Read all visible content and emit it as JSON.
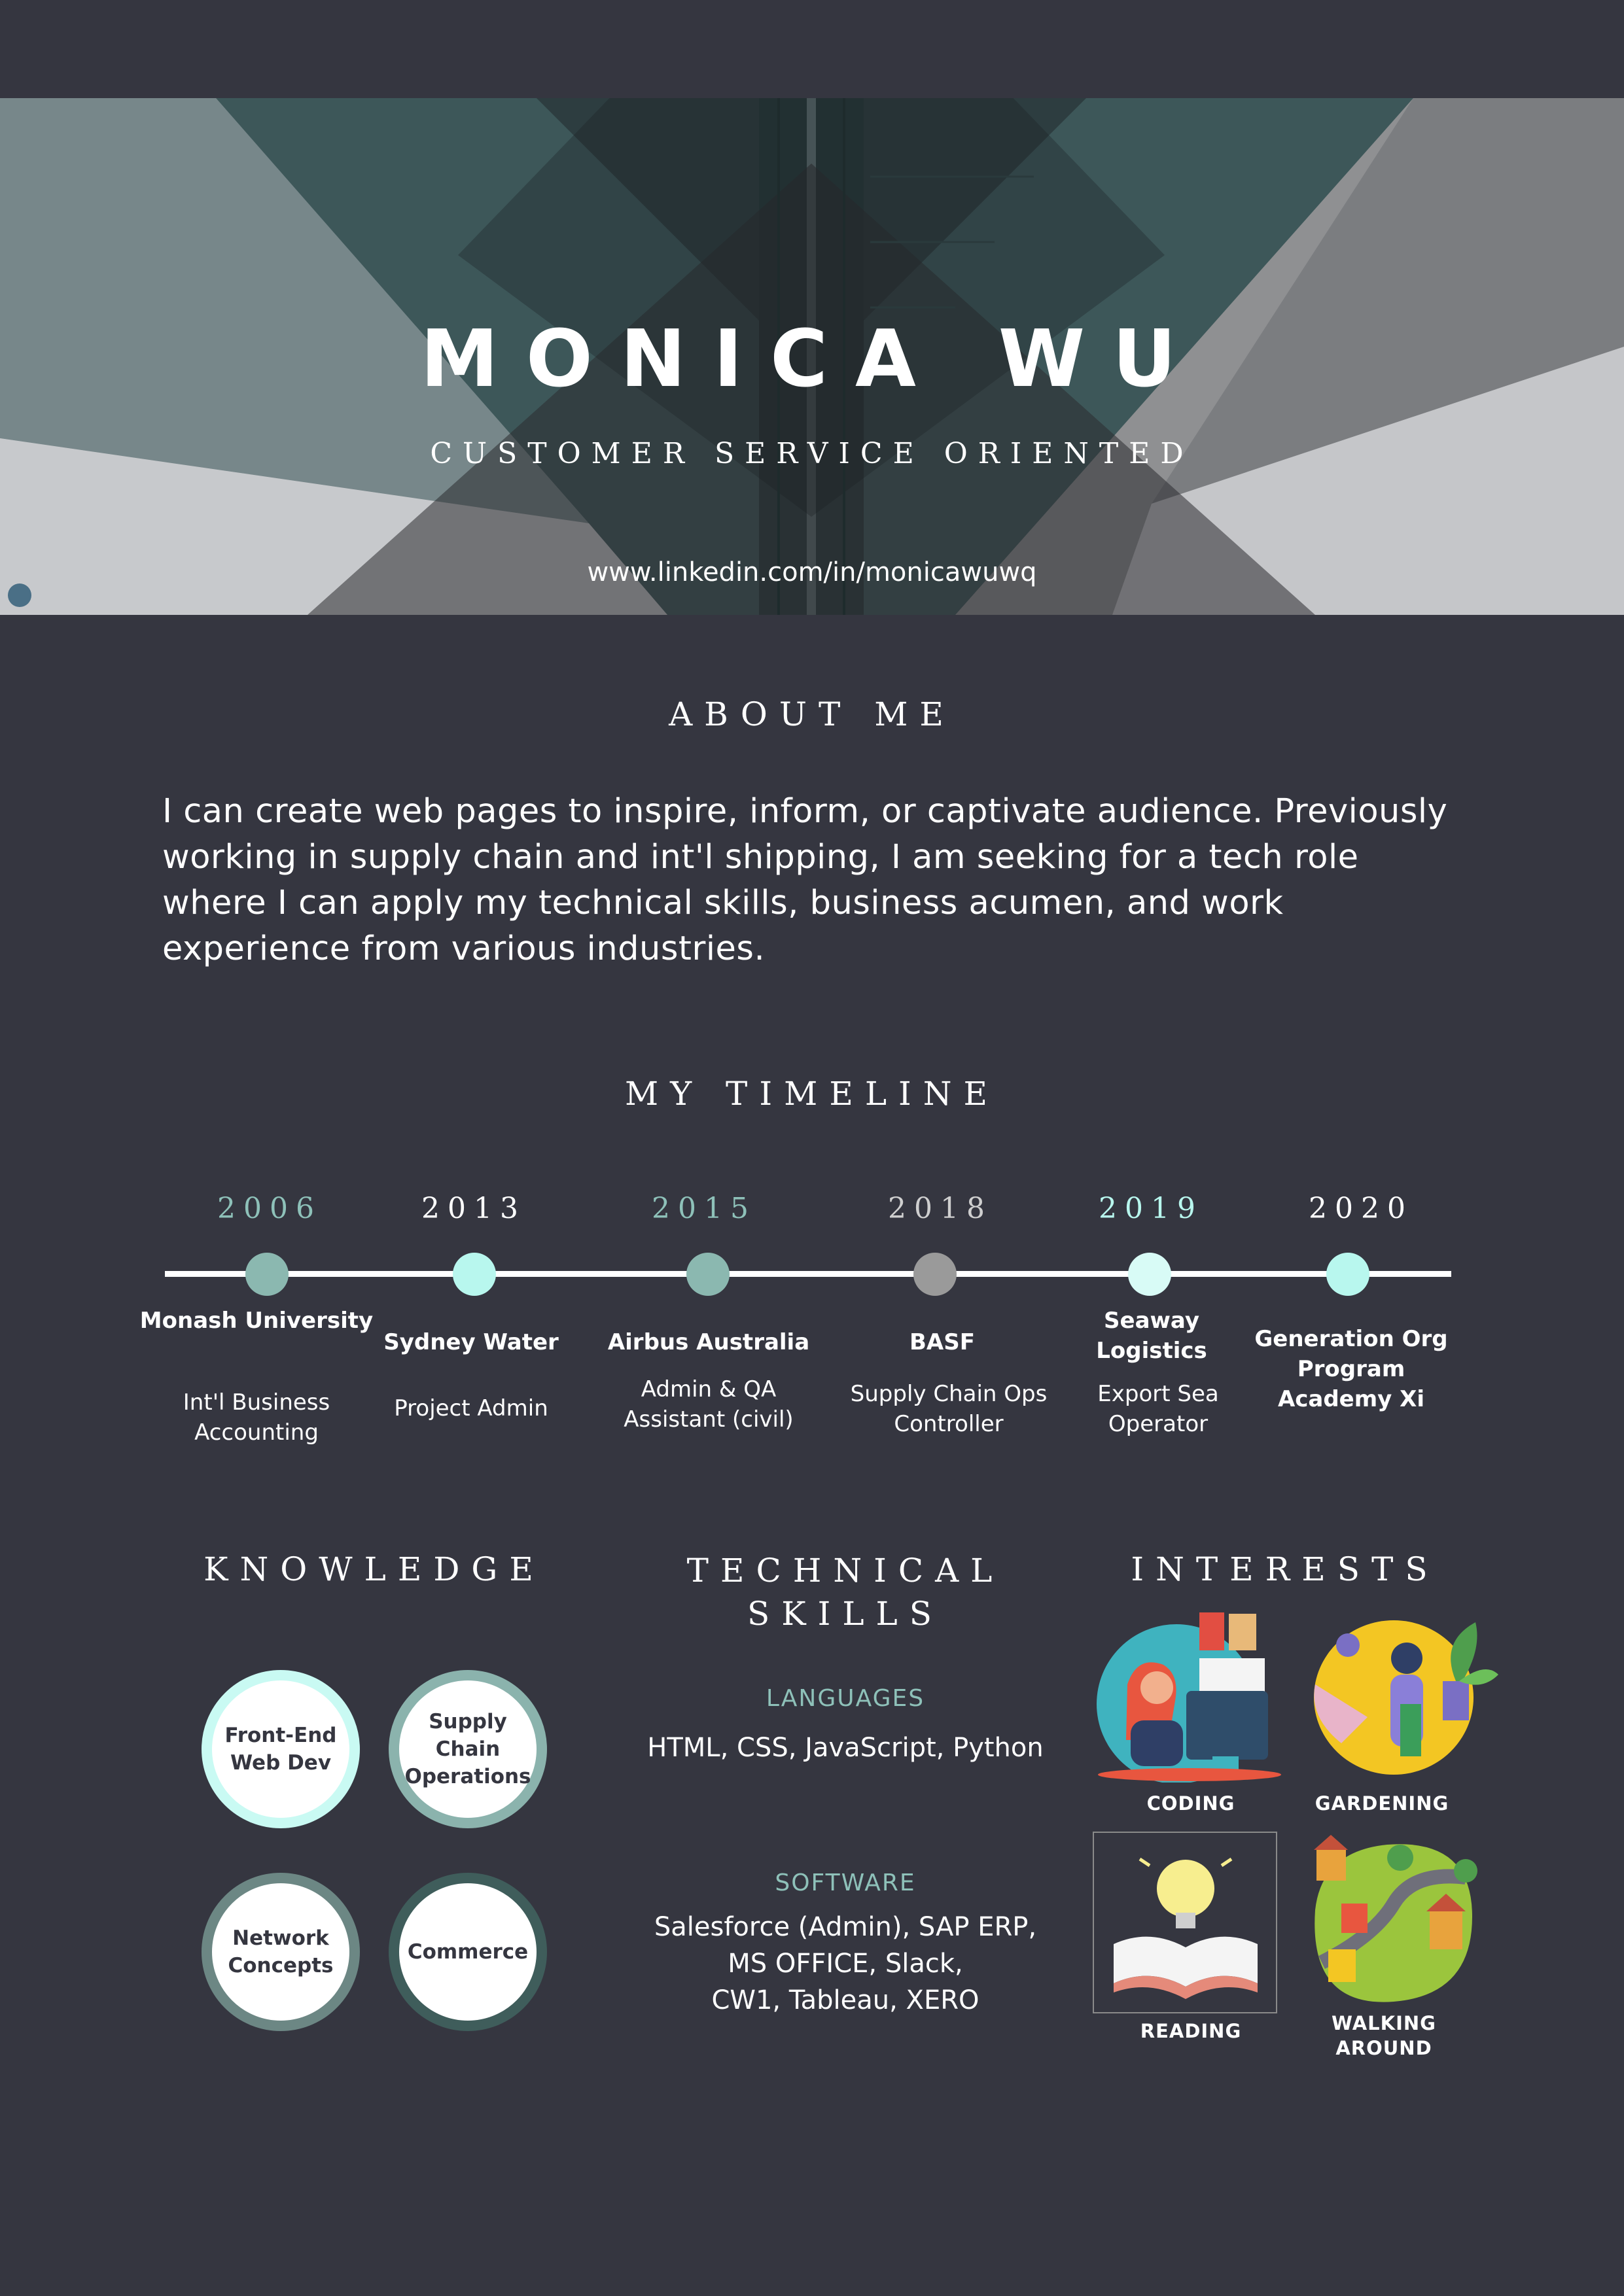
{
  "header": {
    "name": "MONICA WU",
    "tagline": "CUSTOMER SERVICE ORIENTED",
    "linkedin": "www.linkedin.com/in/monicawuwq"
  },
  "about": {
    "title": "ABOUT ME",
    "text": "I can create web pages to inspire, inform, or captivate audience. Previously working in supply chain and int'l shipping, I am seeking for a tech role where I can apply my technical skills, business acumen, and work experience from various industries."
  },
  "timeline": {
    "title": "MY TIMELINE",
    "items": [
      {
        "year": "2006",
        "org": "Monash University",
        "role": "Int'l Business Accounting",
        "year_color": "#8ec1b9",
        "dot_color": "#8bb8b0"
      },
      {
        "year": "2013",
        "org": "Sydney Water",
        "role": "Project Admin",
        "year_color": "#ffffff",
        "dot_color": "#b8f7ee"
      },
      {
        "year": "2015",
        "org": "Airbus Australia",
        "role": "Admin & QA Assistant (civil)",
        "year_color": "#8ec1b9",
        "dot_color": "#8bb8b0"
      },
      {
        "year": "2018",
        "org": "BASF",
        "role": "Supply Chain Ops Controller",
        "year_color": "#cfcfcf",
        "dot_color": "#9a9a9a"
      },
      {
        "year": "2019",
        "org": "Seaway Logistics",
        "role": "Export Sea Operator",
        "year_color": "#b8f7ee",
        "dot_color": "#d8fbf6"
      },
      {
        "year": "2020",
        "org": "Generation Org Program Academy Xi",
        "role": "",
        "year_color": "#ffffff",
        "dot_color": "#b8f7ee"
      }
    ]
  },
  "knowledge": {
    "title": "KNOWLEDGE",
    "items": [
      {
        "label": "Front-End Web Dev",
        "ring_color": "#c9faf3"
      },
      {
        "label": "Supply Chain Operations",
        "ring_color": "#8bb3ad"
      },
      {
        "label": "Network Concepts",
        "ring_color": "#6c8784"
      },
      {
        "label": "Commerce",
        "ring_color": "#3f5d5b"
      }
    ]
  },
  "technical_skills": {
    "title_line1": "TECHNICAL",
    "title_line2": "SKILLS",
    "languages_label": "LANGUAGES",
    "languages": "HTML, CSS, JavaScript, Python",
    "software_label": "SOFTWARE",
    "software_line1": "Salesforce (Admin), SAP ERP,",
    "software_line2": "MS OFFICE, Slack,",
    "software_line3": "CW1, Tableau, XERO"
  },
  "interests": {
    "title": "INTERESTS",
    "items": [
      {
        "label": "CODING",
        "icon": "coding-illustration"
      },
      {
        "label": "GARDENING",
        "icon": "gardening-illustration"
      },
      {
        "label": "READING",
        "icon": "reading-illustration"
      },
      {
        "label": "WALKING AROUND",
        "icon": "walking-illustration"
      }
    ]
  },
  "colors": {
    "background": "#353640",
    "accent_teal": "#8ec1b9",
    "accent_mint": "#b8f7ee"
  }
}
